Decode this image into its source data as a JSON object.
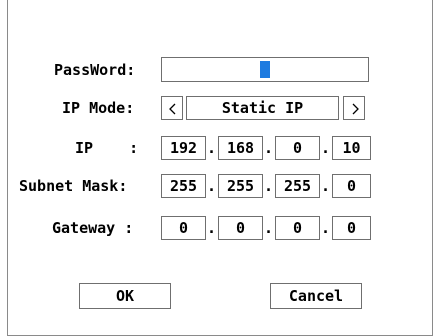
{
  "labels": {
    "password": "PassWord:",
    "ip_mode": "IP Mode:",
    "ip": "IP    :",
    "subnet_mask": "Subnet Mask:",
    "gateway": "Gateway :"
  },
  "password": {
    "value": ""
  },
  "ip_mode": {
    "value": "Static IP",
    "prev_icon": "chevron-left-icon",
    "next_icon": "chevron-right-icon"
  },
  "ip": [
    "192",
    "168",
    "0",
    "10"
  ],
  "subnet_mask": [
    "255",
    "255",
    "255",
    "0"
  ],
  "gateway": [
    "0",
    "0",
    "0",
    "0"
  ],
  "separator": ".",
  "buttons": {
    "ok": "OK",
    "cancel": "Cancel"
  },
  "colors": {
    "cursor": "#1e7be0",
    "border": "#6f6f6f"
  }
}
